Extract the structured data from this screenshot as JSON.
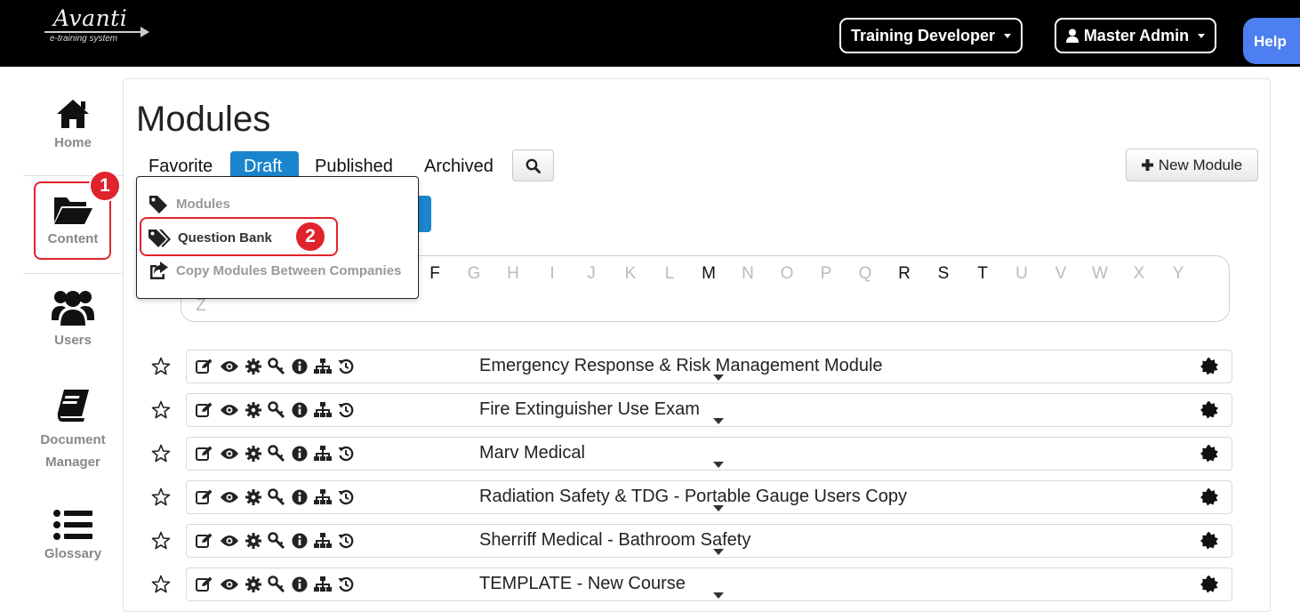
{
  "header": {
    "logo_name": "Avanti",
    "logo_sub": "e-training system",
    "role_label": "Training Developer",
    "user_label": "Master Admin",
    "help_label": "Help"
  },
  "sidebar": {
    "items": [
      {
        "label": "Home",
        "icon": "home-icon"
      },
      {
        "label": "Content",
        "icon": "folder-open-icon"
      },
      {
        "label": "Users",
        "icon": "users-icon"
      },
      {
        "label": "Document Manager",
        "icon": "book-icon"
      },
      {
        "label": "Glossary",
        "icon": "list-icon"
      }
    ]
  },
  "annotations": {
    "badge1": "1",
    "badge2": "2"
  },
  "main": {
    "title": "Modules",
    "tabs": [
      {
        "label": "Favorite"
      },
      {
        "label": "Draft",
        "active": true
      },
      {
        "label": "Published"
      },
      {
        "label": "Archived"
      }
    ],
    "new_module_label": "New Module",
    "alphabet": [
      "F",
      "G",
      "H",
      "I",
      "J",
      "K",
      "L",
      "M",
      "N",
      "O",
      "P",
      "Q",
      "R",
      "S",
      "T",
      "U",
      "V",
      "W",
      "X",
      "Y",
      "Z"
    ],
    "alphabet_active": [
      "F",
      "M",
      "R",
      "S",
      "T"
    ],
    "dropdown": [
      {
        "label": "Modules",
        "icon": "tag-icon"
      },
      {
        "label": "Question Bank",
        "icon": "tags-icon",
        "selected": true
      },
      {
        "label": "Copy Modules Between Companies",
        "icon": "share-icon"
      }
    ],
    "modules": [
      {
        "title": "Emergency Response & Risk Management Module"
      },
      {
        "title": "Fire Extinguisher Use Exam"
      },
      {
        "title": "Marv Medical"
      },
      {
        "title": "Radiation Safety & TDG - Portable Gauge Users Copy"
      },
      {
        "title": "Sherriff Medical - Bathroom Safety"
      },
      {
        "title": "TEMPLATE - New Course"
      }
    ]
  }
}
